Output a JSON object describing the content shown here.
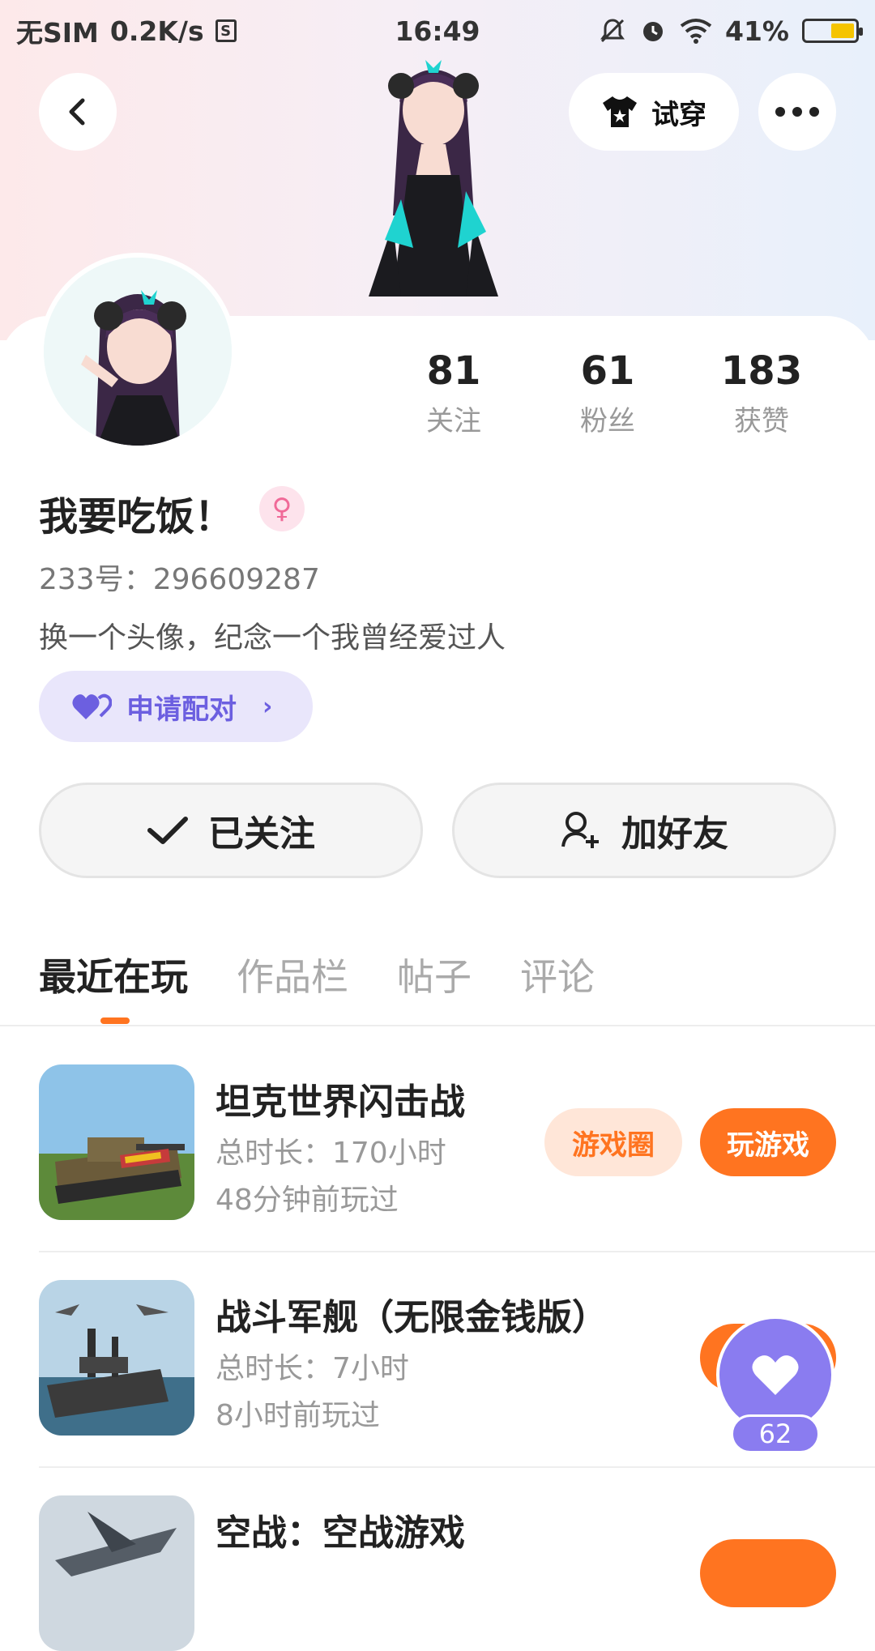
{
  "status_bar": {
    "carrier": "无SIM",
    "speed": "0.2K/s",
    "sim_icon_text": "S",
    "time": "16:49",
    "battery_percent": "41%",
    "battery_level": 0.41
  },
  "header": {
    "tryon_label": "试穿"
  },
  "profile": {
    "stats": [
      {
        "value": "81",
        "label": "关注"
      },
      {
        "value": "61",
        "label": "粉丝"
      },
      {
        "value": "183",
        "label": "获赞"
      }
    ],
    "username": "我要吃饭！",
    "gender_symbol": "♀",
    "uid": "233号：296609287",
    "bio": "换一个头像，纪念一个我曾经爱过人",
    "pair_label": "申请配对",
    "follow_label": "已关注",
    "add_friend_label": "加好友"
  },
  "tabs": [
    {
      "label": "最近在玩",
      "active": true
    },
    {
      "label": "作品栏",
      "active": false
    },
    {
      "label": "帖子",
      "active": false
    },
    {
      "label": "评论",
      "active": false
    }
  ],
  "games": [
    {
      "name": "坦克世界闪击战",
      "total_time": "总时长：170小时",
      "last_played": "48分钟前玩过",
      "circle_label": "游戏圈",
      "play_label": "玩游戏"
    },
    {
      "name": "战斗军舰（无限金钱版）",
      "total_time": "总时长：7小时",
      "last_played": "8小时前玩过",
      "circle_label": "",
      "play_label": ""
    },
    {
      "name": "空战：空战游戏",
      "total_time": "",
      "last_played": "",
      "circle_label": "",
      "play_label": ""
    }
  ],
  "like_fab": {
    "count": "62"
  },
  "colors": {
    "accent_orange": "#ff7420",
    "accent_purple": "#8a7cf0",
    "pair_bg": "#e9e6fb"
  },
  "icons": {
    "back": "chevron-left-icon",
    "tryon": "tshirt-icon",
    "more": "more-dots-icon",
    "pair": "hearts-icon",
    "follow": "check-icon",
    "add_friend": "add-user-icon",
    "like": "heart-icon"
  }
}
